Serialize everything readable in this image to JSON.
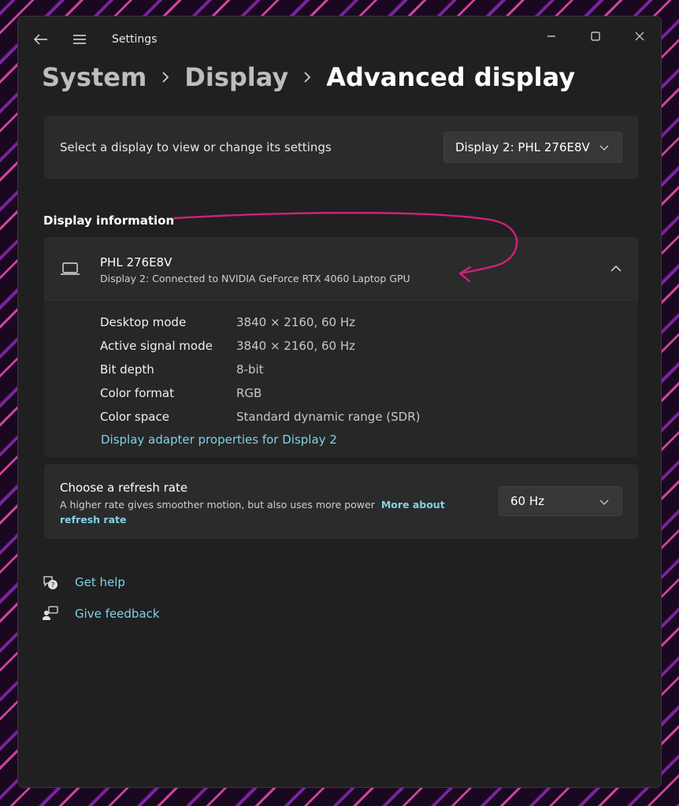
{
  "window": {
    "app_title": "Settings"
  },
  "breadcrumb": {
    "items": [
      "System",
      "Display",
      "Advanced display"
    ]
  },
  "display_selector": {
    "label": "Select a display to view or change its settings",
    "selected": "Display 2: PHL 276E8V"
  },
  "display_information": {
    "title": "Display information",
    "monitor": {
      "name": "PHL 276E8V",
      "subtitle": "Display 2: Connected to NVIDIA GeForce RTX 4060 Laptop GPU"
    },
    "properties": [
      {
        "label": "Desktop mode",
        "value": "3840 × 2160, 60 Hz"
      },
      {
        "label": "Active signal mode",
        "value": "3840 × 2160, 60 Hz"
      },
      {
        "label": "Bit depth",
        "value": "8-bit"
      },
      {
        "label": "Color format",
        "value": "RGB"
      },
      {
        "label": "Color space",
        "value": "Standard dynamic range (SDR)"
      }
    ],
    "adapter_link": "Display adapter properties for Display 2"
  },
  "refresh_rate": {
    "title": "Choose a refresh rate",
    "description": "A higher rate gives smoother motion, but also uses more power",
    "link": "More about refresh rate",
    "selected": "60 Hz"
  },
  "help_links": {
    "get_help": "Get help",
    "give_feedback": "Give feedback"
  },
  "colors": {
    "accent_link": "#7fd2e8",
    "annotation_arrow": "#d0217a",
    "window_bg": "#202020",
    "card_bg": "#2b2b2b"
  }
}
